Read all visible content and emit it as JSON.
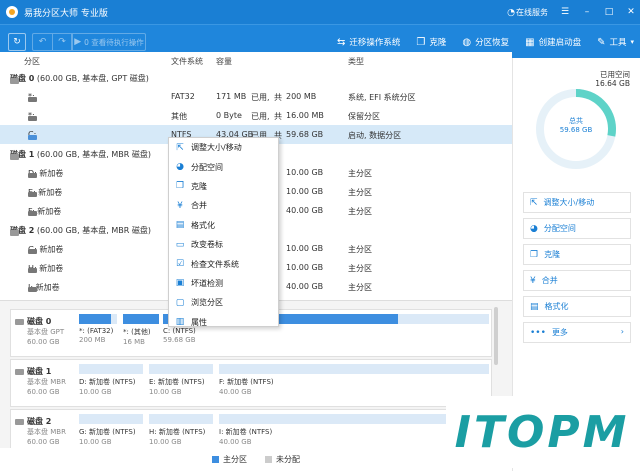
{
  "app": {
    "title": "易我分区大师 专业版",
    "online_service": "在线服务"
  },
  "toolbar": {
    "pending_label": "0 查看待执行操作",
    "tools": [
      {
        "icon": "migrate-icon",
        "label": "迁移操作系统"
      },
      {
        "icon": "clone-icon",
        "label": "克隆"
      },
      {
        "icon": "partition-recovery-icon",
        "label": "分区恢复"
      },
      {
        "icon": "bootable-media-icon",
        "label": "创建启动盘"
      },
      {
        "icon": "tools-icon",
        "label": "工具"
      }
    ]
  },
  "columns": {
    "partition": "分区",
    "filesystem": "文件系统",
    "capacity": "容量",
    "type": "类型"
  },
  "disks": [
    {
      "label": "磁盘 0",
      "info": "(60.00 GB, 基本盘, GPT 磁盘)"
    },
    {
      "label": "磁盘 1",
      "info": "(60.00 GB, 基本盘, MBR 磁盘)"
    },
    {
      "label": "磁盘 2",
      "info": "(60.00 GB, 基本盘, MBR 磁盘)"
    }
  ],
  "partitions": [
    {
      "name": "*:",
      "fs": "FAT32",
      "used": "171 MB",
      "total": "200 MB",
      "type": "系统, EFI 系统分区"
    },
    {
      "name": "*:",
      "fs": "其他",
      "used": "0 Byte",
      "total": "16.00 MB",
      "type": "保留分区"
    },
    {
      "name": "C:",
      "fs": "NTFS",
      "used": "43.04 GB",
      "total": "59.68 GB",
      "type": "启动, 数据分区"
    },
    {
      "name": "D: 新加卷",
      "fs": "NTFS",
      "used": "",
      "total": "10.00 GB",
      "type": "主分区"
    },
    {
      "name": "E: 新加卷",
      "fs": "NTFS",
      "used": "",
      "total": "10.00 GB",
      "type": "主分区"
    },
    {
      "name": "F: 新加卷",
      "fs": "NTFS",
      "used": "",
      "total": "40.00 GB",
      "type": "主分区"
    },
    {
      "name": "G: 新加卷",
      "fs": "NTFS",
      "used": "",
      "total": "10.00 GB",
      "type": "主分区"
    },
    {
      "name": "H: 新加卷",
      "fs": "NTFS",
      "used": "",
      "total": "10.00 GB",
      "type": "主分区"
    },
    {
      "name": "I: 新加卷",
      "fs": "NTFS",
      "used": "",
      "total": "40.00 GB",
      "type": "主分区"
    }
  ],
  "used_word": "已用,",
  "used_of": "共",
  "context_menu": [
    "调整大小/移动",
    "分配空间",
    "克隆",
    "合并",
    "格式化",
    "改变卷标",
    "检查文件系统",
    "坏道检测",
    "浏览分区",
    "属性"
  ],
  "map": {
    "disk0": {
      "name": "磁盘 0",
      "sub1": "基本盘 GPT",
      "sub2": "60.00 GB",
      "parts": [
        {
          "l1": "*: (FAT32)",
          "l2": "200 MB",
          "fill": 0.85
        },
        {
          "l1": "*: (其他)",
          "l2": "16 MB",
          "fill": 1.0
        },
        {
          "l1": "C: (NTFS)",
          "l2": "59.68 GB",
          "fill": 0.72
        }
      ]
    },
    "disk1": {
      "name": "磁盘 1",
      "sub1": "基本盘 MBR",
      "sub2": "60.00 GB",
      "parts": [
        {
          "l1": "D: 新加卷 (NTFS)",
          "l2": "10.00 GB"
        },
        {
          "l1": "E: 新加卷 (NTFS)",
          "l2": "10.00 GB"
        },
        {
          "l1": "F: 新加卷 (NTFS)",
          "l2": "40.00 GB"
        }
      ]
    },
    "disk2": {
      "name": "磁盘 2",
      "sub1": "基本盘 MBR",
      "sub2": "60.00 GB",
      "parts": [
        {
          "l1": "G: 新加卷 (NTFS)",
          "l2": "10.00 GB"
        },
        {
          "l1": "H: 新加卷 (NTFS)",
          "l2": "10.00 GB"
        },
        {
          "l1": "I: 新加卷 (NTFS)",
          "l2": "40.00 GB"
        }
      ]
    }
  },
  "legend": {
    "primary": "主分区",
    "unallocated": "未分配"
  },
  "side": {
    "used_label": "已用空间",
    "used_value": "16.64 GB",
    "total_label": "总共",
    "total_value": "59.68 GB",
    "used_fraction": 0.28,
    "actions": [
      "调整大小/移动",
      "分配空间",
      "克隆",
      "合并",
      "格式化",
      "更多"
    ]
  },
  "watermark": "ITOPM",
  "colors": {
    "accent": "#1a7fd4",
    "partition_fill": "#3d8ee0",
    "donut_used": "#5ed3c8",
    "donut_free": "#e6f1f8"
  }
}
